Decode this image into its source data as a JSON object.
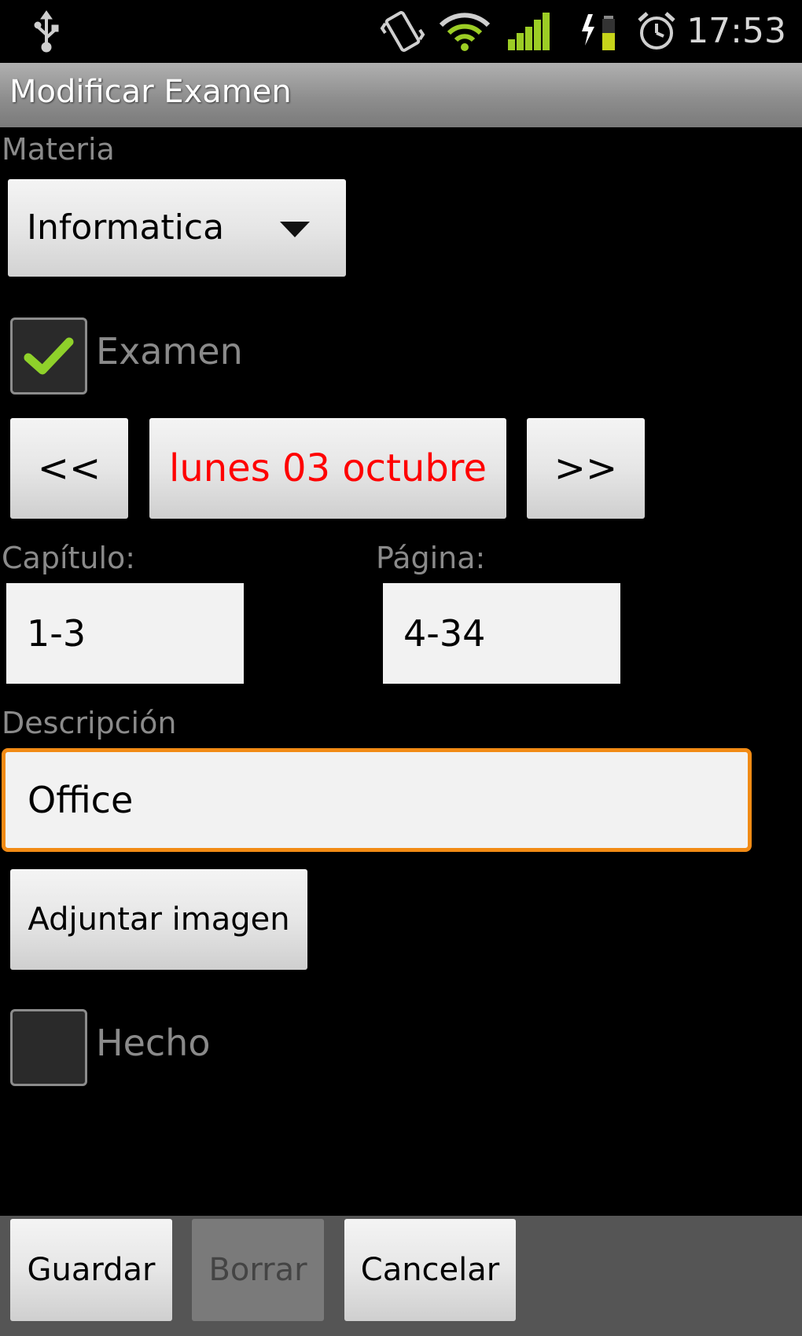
{
  "status_bar": {
    "time": "17:53",
    "icons": [
      "usb-icon",
      "vibrate-icon",
      "wifi-icon",
      "signal-icon",
      "battery-charging-icon",
      "alarm-icon"
    ],
    "colors": {
      "accent_green": "#9ccd25",
      "battery_yellow": "#c7d41a"
    }
  },
  "title_bar": {
    "title": "Modificar Examen"
  },
  "form": {
    "materia_label": "Materia",
    "materia_value": "Informatica",
    "examen_label": "Examen",
    "examen_checked": true,
    "prev_label": "<<",
    "date_label": "lunes 03 octubre",
    "next_label": ">>",
    "date_color": "#ff0000",
    "capitulo_label": "Capítulo:",
    "capitulo_value": "1-3",
    "pagina_label": "Página:",
    "pagina_value": "4-34",
    "descripcion_label": "Descripción",
    "descripcion_value": "Office",
    "focus_color": "#f28b15",
    "adjuntar_label": "Adjuntar imagen",
    "hecho_label": "Hecho",
    "hecho_checked": false
  },
  "actions": {
    "guardar": "Guardar",
    "borrar": "Borrar",
    "borrar_disabled": true,
    "cancelar": "Cancelar"
  }
}
